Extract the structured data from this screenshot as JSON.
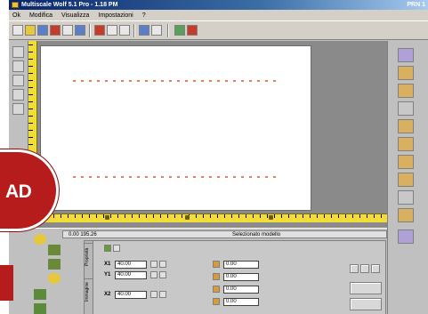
{
  "window": {
    "title": "Multiscale Wolf 5.1 Pro - 1.18 PM",
    "right_label": "PRN 1"
  },
  "menu": [
    "Ok",
    "Modifica",
    "Visualizza",
    "Impostazioni",
    "?"
  ],
  "status": {
    "coordinates": "0.00  195.26",
    "message": "Selezionato modello"
  },
  "properties": {
    "tabs": [
      "Proprietà",
      "Immagine"
    ],
    "fields": [
      {
        "label": "X1",
        "value": "40.00"
      },
      {
        "label": "Y1",
        "value": "40.00"
      },
      {
        "label": "X2",
        "value": "40.00"
      }
    ],
    "right_fields": [
      {
        "label": "1",
        "value": "0.00"
      },
      {
        "label": "2",
        "value": "0.00"
      },
      {
        "label": "3",
        "value": "0.00"
      },
      {
        "label": "4",
        "value": "0.00"
      }
    ]
  },
  "overlay": {
    "badge_text": "AD"
  },
  "icons": {
    "toolbar": [
      "new-icon",
      "open-icon",
      "save-icon",
      "print-icon",
      "cut-icon",
      "copy-icon",
      "paste-icon",
      "undo-icon",
      "zoom-icon",
      "grid-icon",
      "settings-icon",
      "help-icon"
    ],
    "right_panel": [
      "palette-icon",
      "building-icon",
      "hammer-icon",
      "grid-icon",
      "sun-icon",
      "slope-icon",
      "shape-icon",
      "triangle-icon",
      "house-icon",
      "table-icon"
    ]
  },
  "colors": {
    "ruler": "#f2dc3a",
    "canvas_dots": "#e08060",
    "badge": "#b71c1c",
    "title_bar": "#0a246a"
  }
}
